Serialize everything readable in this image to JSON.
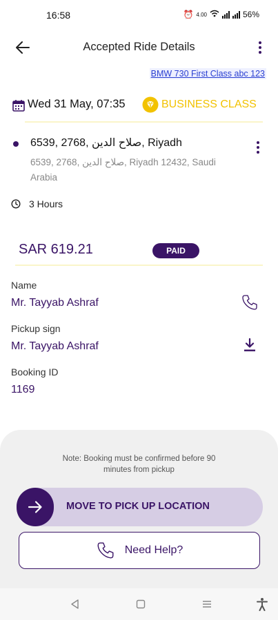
{
  "status_bar": {
    "time": "16:58",
    "data_speed": "4.00",
    "battery": "56%"
  },
  "header": {
    "title": "Accepted Ride Details",
    "back_icon": "arrow-left-icon",
    "menu_icon": "more-vertical-icon"
  },
  "vehicle": {
    "link_text": "BMW 730 First Class  abc 123"
  },
  "ride": {
    "date_time": "Wed 31 May,  07:35",
    "class_label": "BUSINESS CLASS",
    "class_color": "#f2c200",
    "pickup_address": "6539, 2768, صلاح الدين, Riyadh",
    "pickup_address_full": "6539, 2768, صلاح الدين, Riyadh 12432, Saudi Arabia",
    "duration": "3 Hours"
  },
  "payment": {
    "price": "SAR 619.21",
    "status": "PAID"
  },
  "fields": {
    "name_label": "Name",
    "name_value": "Mr. Tayyab Ashraf",
    "pickup_sign_label": "Pickup sign",
    "pickup_sign_value": "Mr. Tayyab Ashraf",
    "booking_id_label": "Booking ID",
    "booking_id_value": "1169"
  },
  "bottom": {
    "note": "Note: Booking must be confirmed before 90 minutes from pickup",
    "move_button": "MOVE TO PICK UP LOCATION",
    "help_button": "Need Help?"
  },
  "colors": {
    "primary": "#3a1466",
    "accent_gold": "#f2c200",
    "link_blue": "#2a3fd1"
  }
}
